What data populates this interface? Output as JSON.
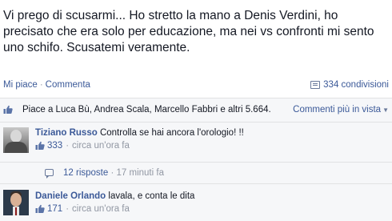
{
  "post": {
    "text": "Vi prego di scusarmi... Ho stretto la mano a Denis Verdini, ho precisato che era solo per educazione, ma nei vs confronti mi sento uno schifo. Scusatemi veramente."
  },
  "actions": {
    "like_label": "Mi piace",
    "separator": "·",
    "comment_label": "Commenta",
    "shares_label": "334 condivisioni",
    "shares_icon": "share-icon"
  },
  "likes": {
    "text": "Piace a Luca Bù, Andrea Scala, Marcello Fabbri e altri 5.664.",
    "sort_label": "Commenti più in vista",
    "sort_caret": "▼",
    "icon": "thumbs-up-icon"
  },
  "comments": [
    {
      "author": "Tiziano Russo",
      "text": "Controlla se hai ancora l'orologio! !!",
      "likes": "333",
      "separator": "·",
      "time": "circa un'ora fa",
      "replies": {
        "label": "12 risposte",
        "separator": "·",
        "time": "17 minuti fa"
      }
    },
    {
      "author": "Daniele Orlando",
      "text": "lavala, e conta le dita",
      "likes": "171",
      "separator": "·",
      "time": "circa un'ora fa"
    }
  ],
  "colors": {
    "link": "#3b5998",
    "muted": "#9197a3",
    "feedback_bg": "#f6f7f9"
  }
}
